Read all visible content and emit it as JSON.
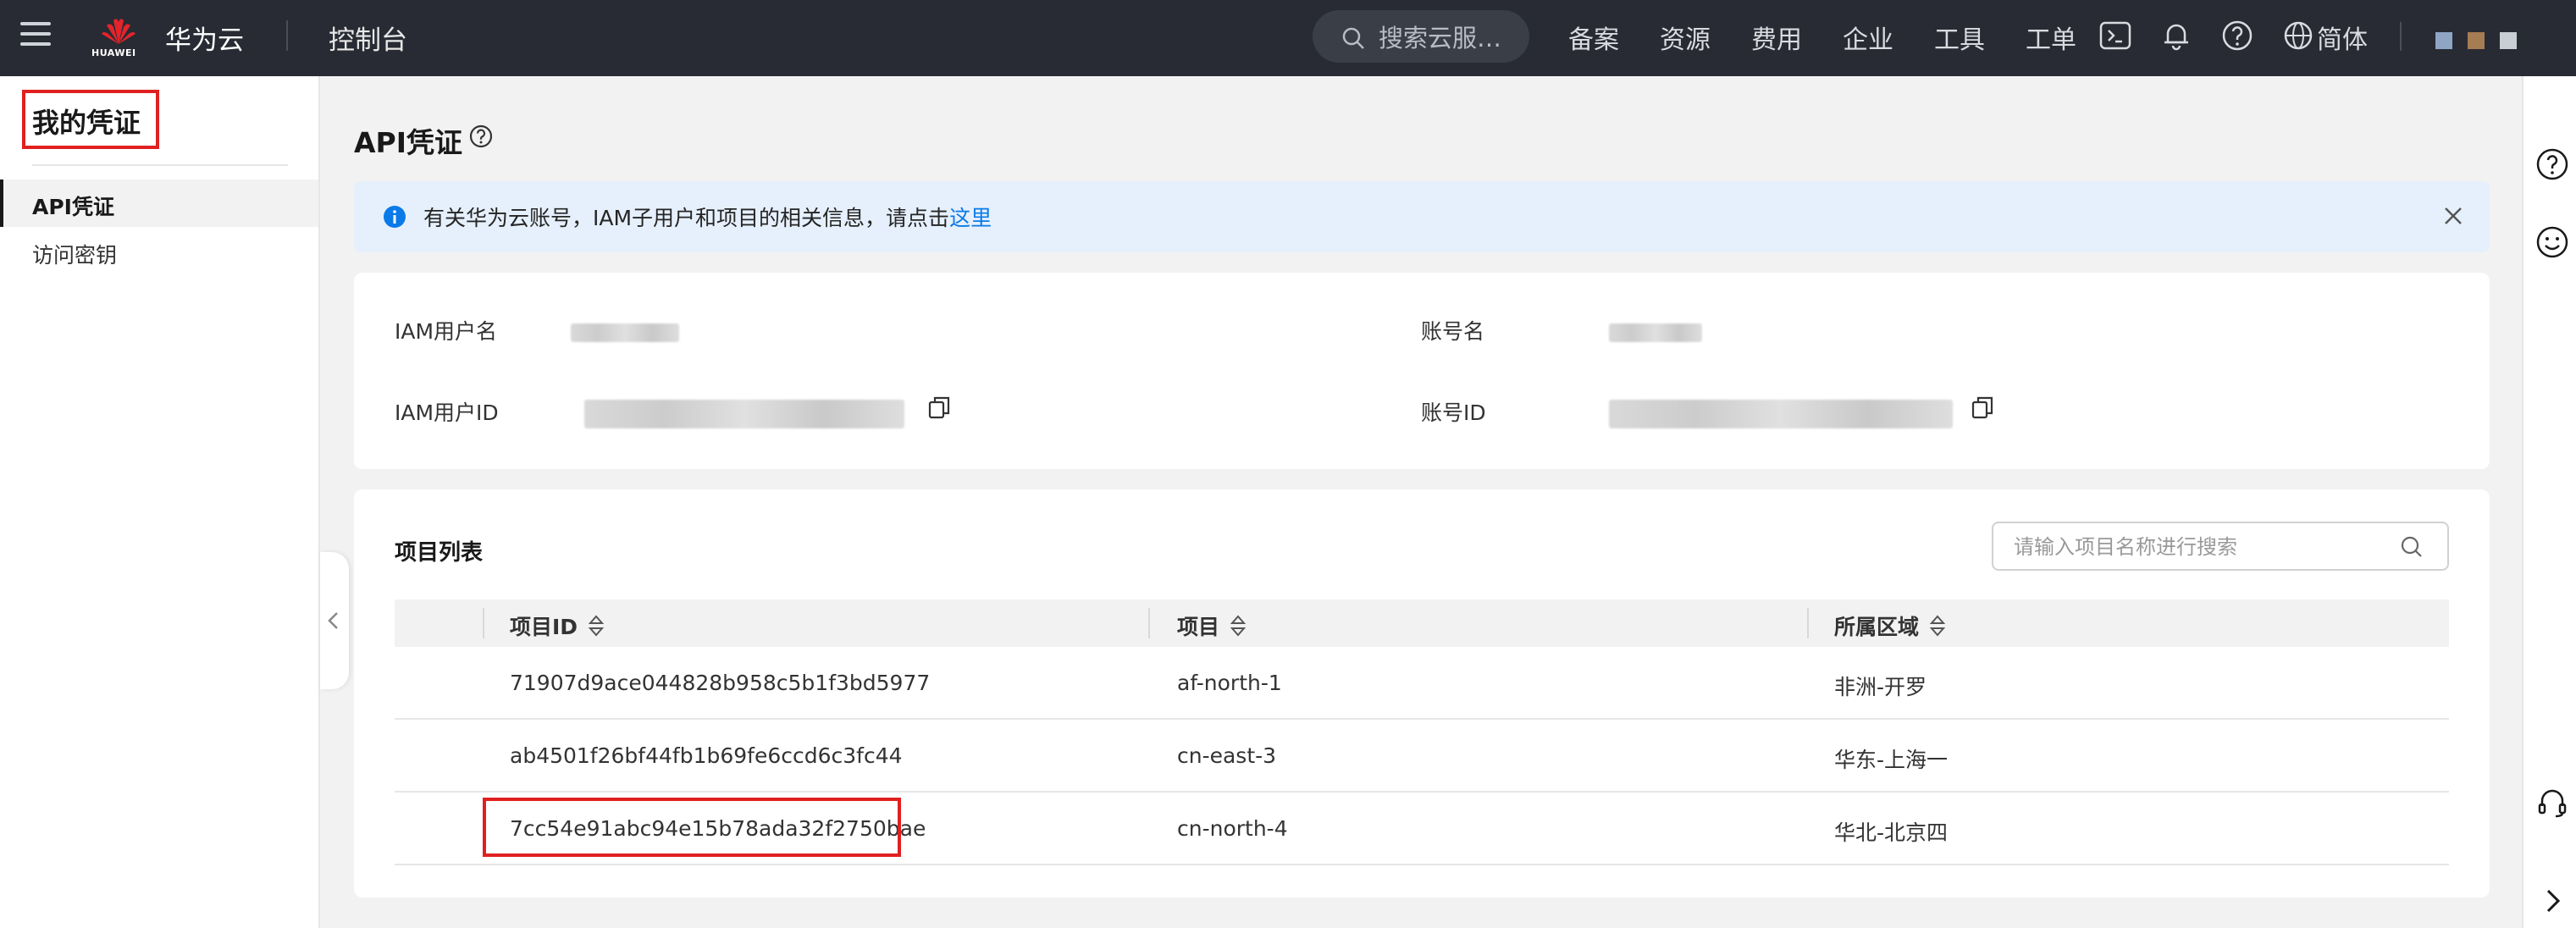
{
  "topbar": {
    "logo_text": "HUAWEI",
    "brand": "华为云",
    "console": "控制台",
    "search_placeholder": "搜索云服…",
    "nav": [
      "备案",
      "资源",
      "费用",
      "企业",
      "工具",
      "工单"
    ],
    "language": "简体"
  },
  "sidebar": {
    "title": "我的凭证",
    "items": [
      {
        "label": "API凭证",
        "active": true
      },
      {
        "label": "访问密钥",
        "active": false
      }
    ]
  },
  "main": {
    "title": "API凭证",
    "notice": {
      "text": "有关华为云账号，IAM子用户和项目的相关信息，请点击",
      "link": "这里"
    },
    "info": {
      "iam_user_name_label": "IAM用户名",
      "account_name_label": "账号名",
      "iam_user_id_label": "IAM用户ID",
      "account_id_label": "账号ID"
    },
    "projects": {
      "title": "项目列表",
      "search_placeholder": "请输入项目名称进行搜索",
      "columns": [
        "项目ID",
        "项目",
        "所属区域"
      ],
      "rows": [
        {
          "id": "71907d9ace044828b958c5b1f3bd5977",
          "project": "af-north-1",
          "region": "非洲-开罗"
        },
        {
          "id": "ab4501f26bf44fb1b69fe6ccd6c3fc44",
          "project": "cn-east-3",
          "region": "华东-上海一"
        },
        {
          "id": "7cc54e91abc94e15b78ada32f2750bae",
          "project": "cn-north-4",
          "region": "华北-北京四"
        }
      ]
    }
  },
  "colors": {
    "topbar_bg": "#282b33",
    "highlight": "#e02020",
    "link": "#0a7ae8",
    "notice_bg": "#e6f0fc"
  }
}
